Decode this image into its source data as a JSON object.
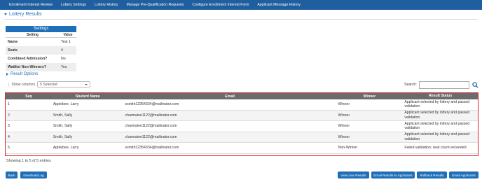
{
  "nav": {
    "items": [
      "Enrollment Interest Review",
      "Lottery Settings",
      "Lottery History",
      "Manage Pre-Qualification Requests",
      "Configure Enrollment Interest Form",
      "Applicant Message History"
    ]
  },
  "section": {
    "title": "Lottery Results"
  },
  "settings": {
    "title": "Settings",
    "col_setting": "Setting",
    "col_value": "Value",
    "rows": [
      {
        "key": "Name",
        "value": "Test 1"
      },
      {
        "key": "Seats",
        "value": "4"
      },
      {
        "key": "Combined Admission?",
        "value": "No"
      },
      {
        "key": "Waitlist Non-Winners?",
        "value": "Yes"
      }
    ]
  },
  "result_options": {
    "label": "Result Options"
  },
  "show_columns": {
    "label": "Show columns",
    "selected": "5 Selected"
  },
  "search": {
    "label": "Search:",
    "value": ""
  },
  "table": {
    "headers": [
      "Seq",
      "Student Name",
      "Email",
      "Winner",
      "Result Status"
    ],
    "rows": [
      {
        "seq": "1",
        "name": "Applebee, Larry",
        "email": "ssmith12354334@mailinator.com",
        "winner": "Winner",
        "status": "Applicant selected by lottery and passed validation"
      },
      {
        "seq": "2",
        "name": "Smith, Sally",
        "email": "charmaine1122@mailinator.com",
        "winner": "Winner",
        "status": "Applicant selected by lottery and passed validation"
      },
      {
        "seq": "3",
        "name": "Smith, Sally",
        "email": "charmaine1122@mailinator.com",
        "winner": "Winner",
        "status": "Applicant selected by lottery and passed validation"
      },
      {
        "seq": "4",
        "name": "Smith, Sally",
        "email": "charmaine1122@mailinator.com",
        "winner": "Winner",
        "status": "Applicant selected by lottery and passed validation"
      },
      {
        "seq": "5",
        "name": "Applebee, Larry",
        "email": "ssmith12354334@mailinator.com",
        "winner": "Non-Winner",
        "status": "Failed validation; seat count exceeded"
      }
    ]
  },
  "footer": {
    "showing": "Showing 1 to 5 of 5 entries"
  },
  "buttons": {
    "back": "Back",
    "download_log": "Download Log",
    "view_live": "View Live Results",
    "email_applicants_results": "Email Results to Applicants",
    "rollback": "Rollback Results",
    "email_applicants": "Email Applicants"
  },
  "colors": {
    "nav_bg": "#1f5f9f",
    "accent": "#1f6fb8",
    "highlight_border": "#d9282f",
    "table_header": "#6b6b6b"
  }
}
